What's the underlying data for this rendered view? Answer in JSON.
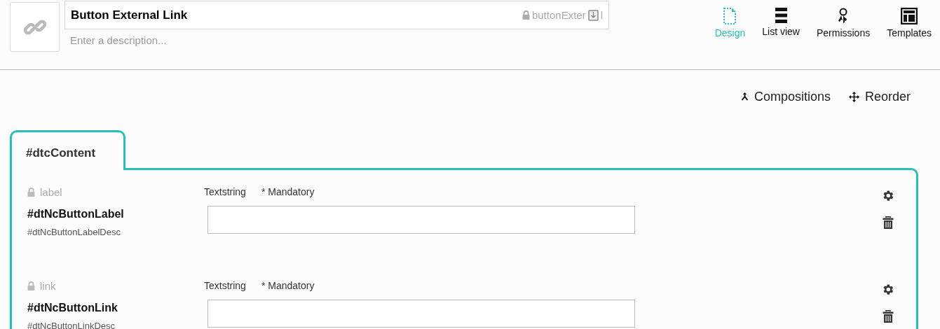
{
  "header": {
    "name": "Button External Link",
    "alias_visible": "buttonExter",
    "alias_tail": "l",
    "description": {
      "placeholder": "Enter a description..."
    }
  },
  "nav": [
    {
      "kind": "design",
      "label": "Design",
      "selected": true
    },
    {
      "kind": "list",
      "label": "List view",
      "selected": false
    },
    {
      "kind": "permissions",
      "label": "Permissions",
      "selected": false
    },
    {
      "kind": "templates",
      "label": "Templates",
      "selected": false
    }
  ],
  "toolbar": [
    {
      "kind": "compositions",
      "label": "Compositions"
    },
    {
      "kind": "reorder",
      "label": "Reorder"
    }
  ],
  "tab": {
    "label": "#dtcContent"
  },
  "properties": [
    {
      "alias": "label",
      "editor": "Textstring",
      "mandatory": "* Mandatory",
      "name": "#dtNcButtonLabel",
      "description": "#dtNcButtonLabelDesc"
    },
    {
      "alias": "link",
      "editor": "Textstring",
      "mandatory": "* Mandatory",
      "name": "#dtNcButtonLink",
      "description": "#dtNcButtonLinkDesc"
    }
  ]
}
